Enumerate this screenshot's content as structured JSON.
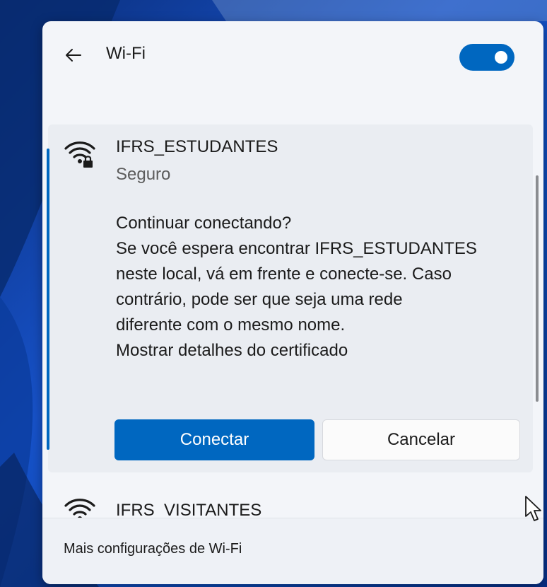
{
  "header": {
    "title": "Wi-Fi",
    "wifi_enabled": true
  },
  "network_expanded": {
    "ssid": "IFRS_ESTUDANTES",
    "status": "Seguro",
    "message_lines": [
      "Continuar conectando?",
      "Se você espera encontrar IFRS_ESTUDANTES",
      "neste local, vá em frente e conecte-se. Caso",
      "contrário, pode ser que seja uma rede",
      "diferente com o mesmo nome."
    ],
    "cert_link": "Mostrar detalhes do certificado",
    "connect_label": "Conectar",
    "cancel_label": "Cancelar"
  },
  "network_next": {
    "ssid": "IFRS_VISITANTES"
  },
  "footer": {
    "more_settings": "Mais configurações de Wi-Fi"
  },
  "colors": {
    "accent": "#0067c0",
    "panel_bg": "#f3f5f9",
    "card_bg": "#eaedf2"
  },
  "icons": [
    "back-arrow-icon",
    "wifi-secured-icon",
    "wifi-icon",
    "mouse-pointer-icon"
  ]
}
